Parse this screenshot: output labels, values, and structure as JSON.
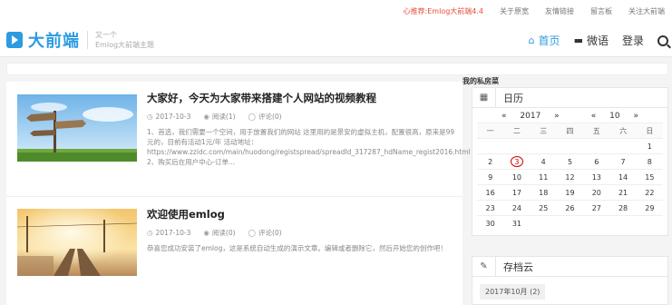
{
  "topbar": {
    "promo": "心推荐:Emlog大前端4.4",
    "links": [
      "关于原宽",
      "友情链接",
      "留言板",
      "关注大前端"
    ]
  },
  "header": {
    "logo_text": "大前端",
    "tagline_1": "又一个",
    "tagline_2": "Emlog大前端主题",
    "nav": [
      {
        "label": "首页",
        "icon": "home-icon",
        "active": true
      },
      {
        "label": "微语",
        "icon": "cup-icon",
        "active": false
      },
      {
        "label": "登录",
        "icon": "",
        "active": false
      }
    ]
  },
  "posts": [
    {
      "title": "大家好，今天为大家带来搭建个人网站的视频教程",
      "date": "2017-10-3",
      "views": "阅读(1)",
      "comments": "评论(0)",
      "excerpt": "1、首选，我们需要一个空间，用于放置我们的网站 这里用的是景安的虚拟主机，配置很高，原来是99元的，目前有活动1元/年 活动地址：https://www.zzidc.com/main/huodong/registspread/spreadId_317287_hdName_regist2016.html 2、购买后在用户中心-订单...",
      "image": "signpost-image"
    },
    {
      "title": "欢迎使用emlog",
      "date": "2017-10-3",
      "views": "阅读(0)",
      "comments": "评论(0)",
      "excerpt": "恭喜您成功安装了emlog，这是系统自动生成的演示文章。编辑或者删除它，然后开始您的创作吧！",
      "image": "railway-image"
    }
  ],
  "sidebar": {
    "section_title": "我的私房菜",
    "calendar": {
      "title": "日历",
      "year_prev": "«",
      "year": "2017",
      "year_next": "»",
      "month_prev": "«",
      "month": "10",
      "month_next": "»",
      "weekdays": [
        "一",
        "二",
        "三",
        "四",
        "五",
        "六",
        "日"
      ],
      "days": [
        "",
        "",
        "",
        "",
        "",
        "",
        "1",
        "2",
        "3",
        "4",
        "5",
        "6",
        "7",
        "8",
        "9",
        "10",
        "11",
        "12",
        "13",
        "14",
        "15",
        "16",
        "17",
        "18",
        "19",
        "20",
        "21",
        "22",
        "23",
        "24",
        "25",
        "26",
        "27",
        "28",
        "29",
        "30",
        "31",
        "",
        "",
        "",
        "",
        ""
      ],
      "today": "3"
    },
    "archive": {
      "title": "存档云",
      "items": [
        "2017年10月 (2)"
      ]
    }
  },
  "colors": {
    "accent": "#2d9be0",
    "promo": "#e74c3c",
    "today_circle": "#cc0000"
  }
}
